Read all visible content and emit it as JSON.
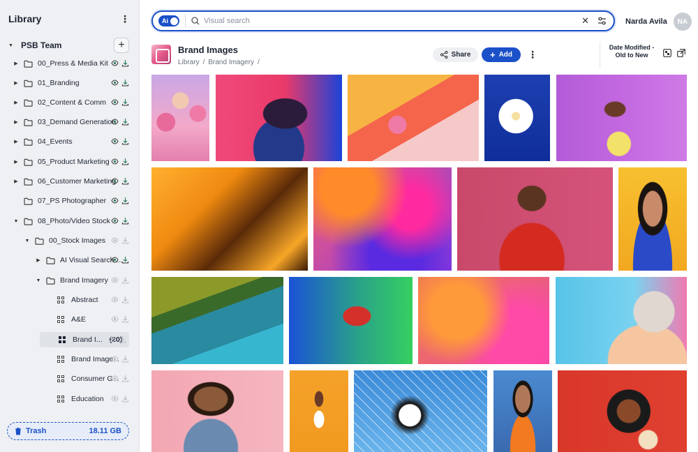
{
  "sidebar": {
    "title": "Library",
    "team": "PSB Team",
    "items": [
      {
        "label": "00_Press & Media Kit"
      },
      {
        "label": "01_Branding"
      },
      {
        "label": "02_Content & Comm"
      },
      {
        "label": "03_Demand Generation"
      },
      {
        "label": "04_Events"
      },
      {
        "label": "05_Product Marketing"
      },
      {
        "label": "06_Customer Marketing"
      },
      {
        "label": "07_PS Photographer"
      },
      {
        "label": "08_Photo/Video Stock"
      },
      {
        "label": "00_Stock Images"
      },
      {
        "label": "AI Visual Search ..."
      },
      {
        "label": "Brand Imagery"
      },
      {
        "label": "Abstract"
      },
      {
        "label": "A&E"
      },
      {
        "label": "Brand I...",
        "count": "(20)"
      },
      {
        "label": "Brand Image..."
      },
      {
        "label": "Consumer G..."
      },
      {
        "label": "Education"
      }
    ],
    "trash": {
      "label": "Trash",
      "size": "18.11 GB"
    }
  },
  "search": {
    "ai_label": "Ai",
    "placeholder": "Visual search"
  },
  "user": {
    "name": "Narda Avila",
    "initials": "NA"
  },
  "header": {
    "title": "Brand Images",
    "breadcrumbs": [
      "Library",
      "/",
      "Brand Imagery",
      "/"
    ],
    "share_label": "Share",
    "add_label": "Add",
    "sort_label": "Date Modified - Old to New"
  },
  "colors": {
    "accent": "#1a50c8",
    "sidebar_bg": "#eef0f3"
  },
  "images": [
    {
      "name": "woman-pink-flowers"
    },
    {
      "name": "woman-neon-sunglasses"
    },
    {
      "name": "tennis-ball-pastel"
    },
    {
      "name": "white-dahlia-blue"
    },
    {
      "name": "tennis-player-purple"
    },
    {
      "name": "orange-arches"
    },
    {
      "name": "abstract-pink-blue-gradient"
    },
    {
      "name": "man-headphones-pink"
    },
    {
      "name": "woman-makeup-yellow"
    },
    {
      "name": "aerial-river-field"
    },
    {
      "name": "dancer-neon"
    },
    {
      "name": "abstract-silk-waves"
    },
    {
      "name": "football-helmet"
    },
    {
      "name": "man-smiling-pink"
    },
    {
      "name": "runner-orange"
    },
    {
      "name": "soccer-ball-net"
    },
    {
      "name": "young-man-orange-shirt"
    },
    {
      "name": "food-bowl-red"
    }
  ]
}
